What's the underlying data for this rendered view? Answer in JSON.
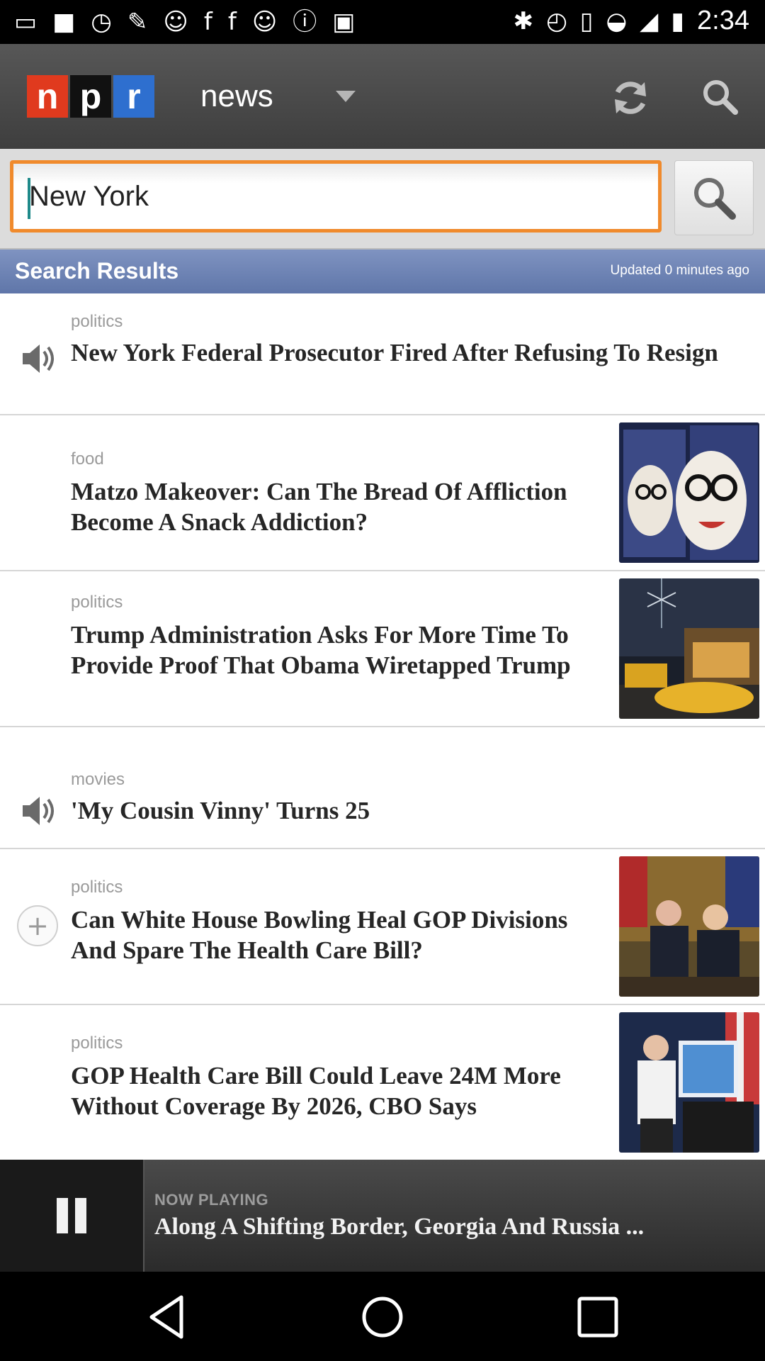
{
  "status_bar": {
    "time": "2:34",
    "left_icons": [
      "message-icon",
      "square-icon",
      "timer-icon",
      "wrench-icon",
      "smiley-icon",
      "facebook-icon",
      "facebook-icon",
      "smiley-icon",
      "info-icon",
      "lock-icon",
      "bluetooth-icon",
      "alarm-icon",
      "vibrate-icon",
      "wifi-icon",
      "signal-icon",
      "battery-icon"
    ]
  },
  "app_bar": {
    "logo_letters": [
      "n",
      "p",
      "r"
    ],
    "section_label": "news",
    "colors": {
      "n": "#e03a1e",
      "p": "#111111",
      "r": "#2e6fcf"
    }
  },
  "search": {
    "value": "New York",
    "accent_color": "#f08a2c"
  },
  "results_header": {
    "title": "Search Results",
    "updated": "Updated 0 minutes ago"
  },
  "results": [
    {
      "category": "politics",
      "headline": "New York Federal Prosecutor Fired After Refusing To Resign",
      "icon": "speaker-icon",
      "has_thumb": false
    },
    {
      "category": "food",
      "headline": "Matzo Makeover: Can The Bread Of Affliction Become A Snack Addiction?",
      "icon": "",
      "has_thumb": true
    },
    {
      "category": "politics",
      "headline": "Trump Administration Asks For More Time To Provide Proof That Obama Wiretapped Trump",
      "icon": "",
      "has_thumb": true
    },
    {
      "category": "movies",
      "headline": "'My Cousin Vinny' Turns 25",
      "icon": "speaker-icon",
      "has_thumb": false
    },
    {
      "category": "politics",
      "headline": "Can White House Bowling Heal GOP Divisions And Spare The Health Care Bill?",
      "icon": "plus-icon",
      "has_thumb": true
    },
    {
      "category": "politics",
      "headline": "GOP Health Care Bill Could Leave 24M More Without Coverage By 2026, CBO Says",
      "icon": "",
      "has_thumb": true
    }
  ],
  "now_playing": {
    "label": "NOW PLAYING",
    "title": "Along A Shifting Border, Georgia And Russia ..."
  },
  "nav": {
    "back": "back-icon",
    "home": "home-icon",
    "recents": "recents-icon"
  }
}
